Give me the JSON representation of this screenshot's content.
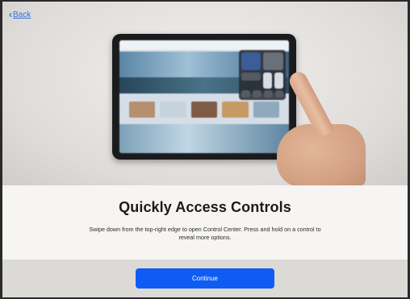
{
  "nav": {
    "back_label": "Back"
  },
  "onboarding": {
    "title": "Quickly Access Controls",
    "description": "Swipe down from the top-right edge to open Control Center. Press and hold on a control to reveal more options."
  },
  "actions": {
    "continue_label": "Continue"
  },
  "colors": {
    "accent": "#0f5cf5",
    "link": "#2f6fdc",
    "background": "#f6f5f3"
  }
}
